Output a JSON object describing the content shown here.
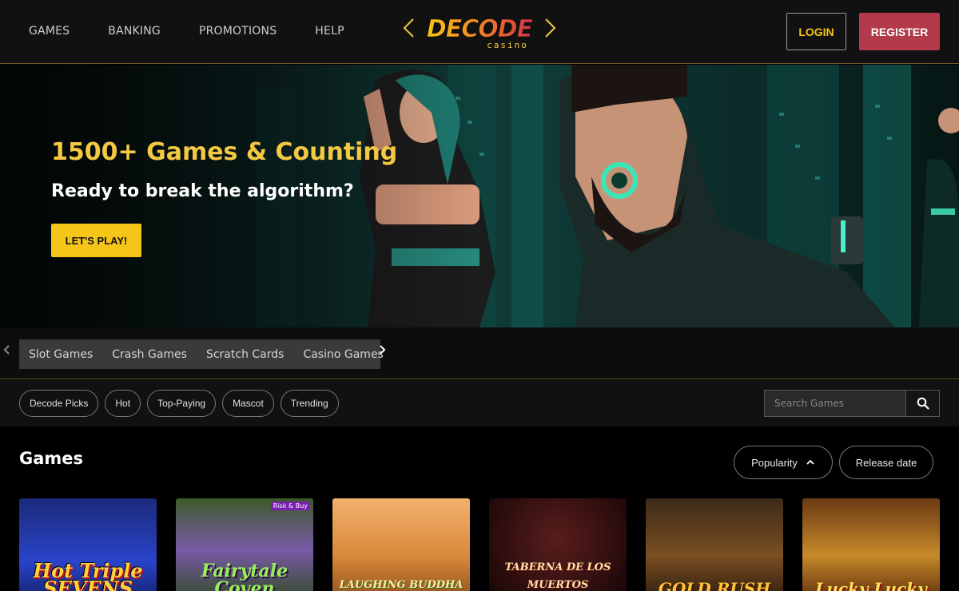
{
  "header": {
    "nav": [
      "GAMES",
      "BANKING",
      "PROMOTIONS",
      "HELP"
    ],
    "logo_text": "DECODE",
    "logo_sub": "casino",
    "login_label": "LOGIN",
    "register_label": "REGISTER",
    "colors": {
      "accent": "#f5c518",
      "register": "#b23a4a",
      "border": "#6b5a24"
    }
  },
  "hero": {
    "title": "1500+ Games & Counting",
    "subtitle": "Ready to break the algorithm?",
    "cta_label": "LET'S PLAY!"
  },
  "categories": {
    "prev_icon": "chevron-left-icon",
    "tabs": [
      "Slot Games",
      "Crash Games",
      "Scratch Cards",
      "Casino Games"
    ],
    "next_icon": "chevron-right-icon"
  },
  "filters": {
    "pills": [
      "Decode Picks",
      "Hot",
      "Top-Paying",
      "Mascot",
      "Trending"
    ],
    "search_placeholder": "Search Games",
    "search_icon": "search-icon"
  },
  "games": {
    "title": "Games",
    "sort_popularity": "Popularity",
    "sort_release": "Release date",
    "tiles": [
      {
        "label": "Hot Triple SEVENS"
      },
      {
        "label": "Fairytale Coven",
        "badge": "Risk & Buy"
      },
      {
        "label": "LAUGHING BUDDHA"
      },
      {
        "label": "TABERNA DE LOS MUERTOS"
      },
      {
        "label": "GOLD RUSH"
      },
      {
        "label": "Lucky Lucky"
      }
    ]
  }
}
